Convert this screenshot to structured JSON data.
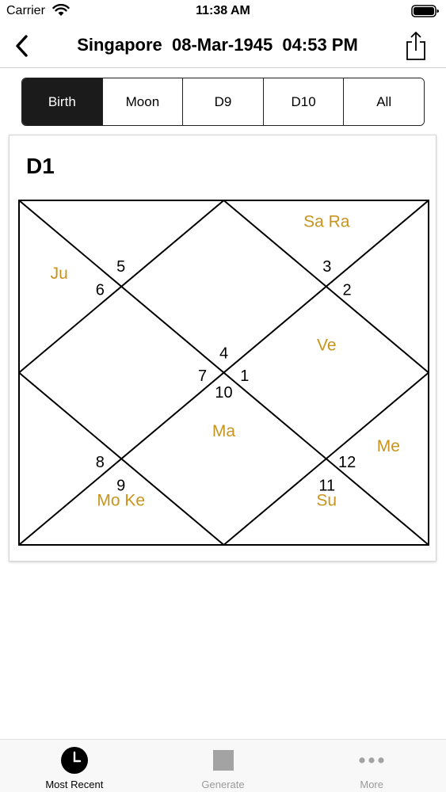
{
  "status_bar": {
    "carrier": "Carrier",
    "time": "11:38 AM"
  },
  "nav": {
    "title": "Singapore  08-Mar-1945  04:53 PM",
    "back_icon": "chevron-left-icon",
    "share_icon": "share-icon"
  },
  "segments": [
    {
      "label": "Birth",
      "active": true
    },
    {
      "label": "Moon",
      "active": false
    },
    {
      "label": "D9",
      "active": false
    },
    {
      "label": "D10",
      "active": false
    },
    {
      "label": "All",
      "active": false
    }
  ],
  "chart": {
    "heading": "D1",
    "planet_color": "#c8941e",
    "line_color": "#000000",
    "houses": [
      {
        "sign": "1",
        "planets": [
          "Ve"
        ]
      },
      {
        "sign": "2",
        "planets": [
          "Sa",
          "Ra"
        ]
      },
      {
        "sign": "3",
        "planets": []
      },
      {
        "sign": "4",
        "planets": []
      },
      {
        "sign": "5",
        "planets": [
          "Ju"
        ]
      },
      {
        "sign": "6",
        "planets": []
      },
      {
        "sign": "7",
        "planets": []
      },
      {
        "sign": "8",
        "planets": []
      },
      {
        "sign": "9",
        "planets": [
          "Mo",
          "Ke"
        ]
      },
      {
        "sign": "10",
        "planets": [
          "Ma"
        ]
      },
      {
        "sign": "11",
        "planets": [
          "Su"
        ]
      },
      {
        "sign": "12",
        "planets": [
          "Me"
        ]
      }
    ]
  },
  "tabs": [
    {
      "label": "Most Recent",
      "icon": "clock-icon",
      "active": true
    },
    {
      "label": "Generate",
      "icon": "square-icon",
      "active": false
    },
    {
      "label": "More",
      "icon": "more-dots-icon",
      "active": false
    }
  ]
}
